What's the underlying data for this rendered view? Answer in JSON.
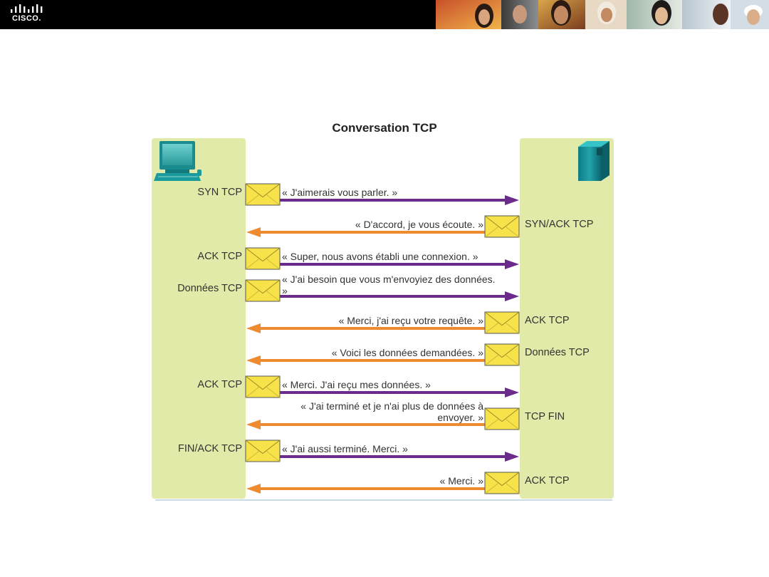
{
  "header": {
    "logo_text": "CISCO.",
    "logo_icon": "cisco-bridge-bars-icon",
    "photo_strip": "people-photo-strip"
  },
  "diagram": {
    "title": "Conversation TCP",
    "client_icon": "computer-workstation-icon",
    "server_icon": "server-tower-icon",
    "envelope_icon": "envelope-icon",
    "colors": {
      "lane_fill": "#e2eaa9",
      "client_to_server_arrow": "#6a2b8c",
      "server_to_client_arrow": "#ee8a2f",
      "envelope_fill": "#f8e24a"
    },
    "messages": [
      {
        "side": "client",
        "direction": "to-server",
        "segment": "SYN TCP",
        "text": "« J'aimerais vous parler. »"
      },
      {
        "side": "server",
        "direction": "to-client",
        "segment": "SYN/ACK TCP",
        "text": "« D'accord, je vous écoute. »"
      },
      {
        "side": "client",
        "direction": "to-server",
        "segment": "ACK TCP",
        "text": "« Super, nous avons établi une connexion. »"
      },
      {
        "side": "client",
        "direction": "to-server",
        "segment": "Données TCP",
        "text": "« J'ai besoin que vous m'envoyiez des données. »"
      },
      {
        "side": "server",
        "direction": "to-client",
        "segment": "ACK TCP",
        "text": "« Merci, j'ai reçu votre requête. »"
      },
      {
        "side": "server",
        "direction": "to-client",
        "segment": "Données TCP",
        "text": "« Voici les données demandées. »"
      },
      {
        "side": "client",
        "direction": "to-server",
        "segment": "ACK TCP",
        "text": "« Merci. J'ai reçu mes données. »"
      },
      {
        "side": "server",
        "direction": "to-client",
        "segment": "TCP FIN",
        "text": "« J'ai terminé et je n'ai plus de données à envoyer. »"
      },
      {
        "side": "client",
        "direction": "to-server",
        "segment": "FIN/ACK TCP",
        "text": "« J'ai aussi terminé. Merci. »"
      },
      {
        "side": "server",
        "direction": "to-client",
        "segment": "ACK TCP",
        "text": "« Merci. »"
      }
    ]
  }
}
